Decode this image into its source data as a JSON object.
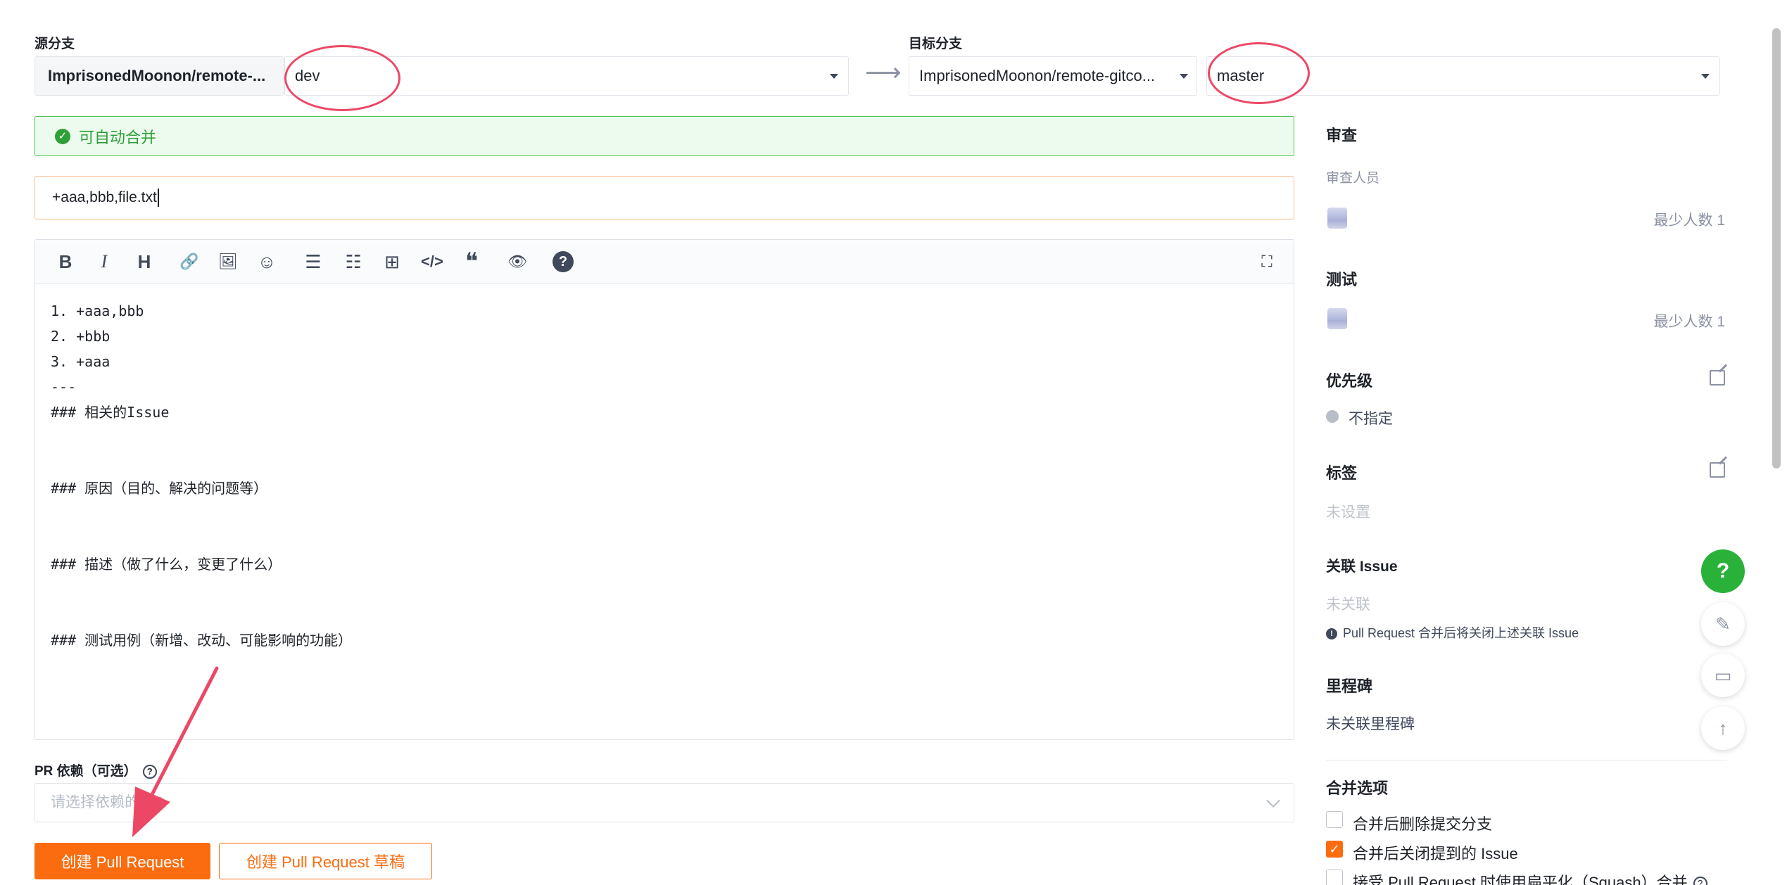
{
  "source": {
    "label": "源分支",
    "repo": "ImprisonedMoonon/remote-...",
    "branch": "dev"
  },
  "arrow": "⟶",
  "target": {
    "label": "目标分支",
    "repo": "ImprisonedMoonon/remote-gitco...",
    "branch": "master"
  },
  "merge_status": "可自动合并",
  "title_value": "+aaa,bbb,file.txt",
  "toolbar": {
    "bold": "B",
    "italic": "I",
    "heading": "H",
    "link": "🔗",
    "image": "🖼",
    "emoji": "☺",
    "ul": "☰",
    "ol": "☷",
    "table": "⊞",
    "code": "</>",
    "quote": "❝",
    "preview": "👁",
    "help": "?",
    "fullscreen": "⛶"
  },
  "body_lines": [
    "1. +aaa,bbb",
    "2. +bbb",
    "3. +aaa",
    "---",
    "### 相关的Issue",
    "",
    "",
    "### 原因（目的、解决的问题等）",
    "",
    "",
    "### 描述（做了什么，变更了什么）",
    "",
    "",
    "### 测试用例（新增、改动、可能影响的功能）"
  ],
  "dependency": {
    "label": "PR 依赖（可选）",
    "placeholder": "请选择依赖的 PR"
  },
  "buttons": {
    "create": "创建 Pull Request",
    "draft": "创建 Pull Request 草稿"
  },
  "sidebar": {
    "review_title": "审查",
    "reviewers_label": "审查人员",
    "review_min": "最少人数 1",
    "test_title": "测试",
    "test_min": "最少人数 1",
    "priority_title": "优先级",
    "priority_value": "不指定",
    "tags_title": "标签",
    "tags_value": "未设置",
    "issue_title": "关联 Issue",
    "issue_value": "未关联",
    "issue_note": "Pull Request 合并后将关闭上述关联 Issue",
    "milestone_title": "里程碑",
    "milestone_value": "未关联里程碑",
    "merge_title": "合并选项",
    "opt_delete_branch": "合并后删除提交分支",
    "opt_close_issue": "合并后关闭提到的 Issue",
    "opt_squash": "接受 Pull Request 时使用扁平化（Squash）合并"
  },
  "colors": {
    "accent": "#fa6c0f",
    "success": "#2f9f39",
    "annotation": "#ec4866"
  }
}
